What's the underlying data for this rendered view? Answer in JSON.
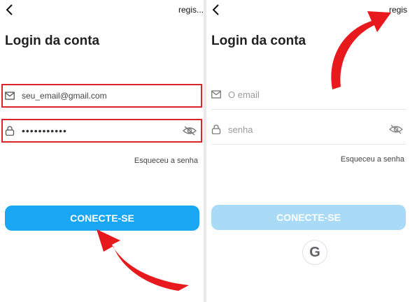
{
  "colors": {
    "accent_active": "#19a6f2",
    "accent_disabled": "#a9daf6",
    "highlight_red": "#d9262a",
    "arrow_red": "#e8191c"
  },
  "left": {
    "register_label": "regis...",
    "title": "Login da conta",
    "email": {
      "value": "seu_email@gmail.com",
      "icon": "mail-icon"
    },
    "password": {
      "value": "•••••••••••",
      "icon": "lock-icon",
      "toggle_icon": "eye-off-icon"
    },
    "forgot_label": "Esqueceu a senha",
    "connect_label": "CONECTE-SE"
  },
  "right": {
    "register_label": "regis",
    "title": "Login da conta",
    "email": {
      "placeholder": "O email",
      "icon": "mail-icon"
    },
    "password": {
      "placeholder": "senha",
      "icon": "lock-icon",
      "toggle_icon": "eye-off-icon"
    },
    "forgot_label": "Esqueceu a senha",
    "connect_label": "CONECTE-SE",
    "google_label": "G"
  }
}
